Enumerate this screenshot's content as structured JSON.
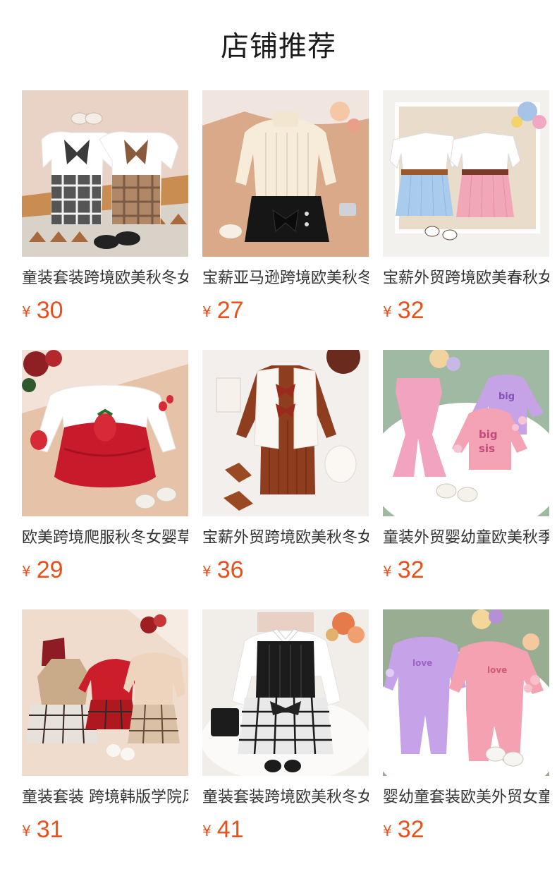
{
  "header": {
    "title": "店铺推荐"
  },
  "currency_symbol": "¥",
  "colors": {
    "price": "#e8501c",
    "title": "#1a1a1a",
    "name": "#333333"
  },
  "products": [
    {
      "name": "童装套装跨境欧美秋冬女童长袖上衣格子半身裙两件套",
      "price": "30",
      "image": "white-bow-tops-plaid-skirts-photo"
    },
    {
      "name": "宝薪亚马逊跨境欧美秋冬女童针织上衣蝴蝶结短裤套装",
      "price": "27",
      "image": "cream-knit-top-black-bow-skort-photo"
    },
    {
      "name": "宝薪外贸跨境欧美春秋女童吊带上衣百褶裙两件套",
      "price": "32",
      "image": "white-tops-blue-pink-pleated-skirts-photo"
    },
    {
      "name": "欧美跨境爬服秋冬女婴草莓连体衣哈衣",
      "price": "29",
      "image": "white-red-strawberry-romper-photo"
    },
    {
      "name": "宝薪外贸跨境欧美秋冬女童毛绒马甲针织裙套装",
      "price": "36",
      "image": "brown-dress-white-fur-vest-photo"
    },
    {
      "name": "童装外贸婴幼童欧美秋季女童卫衣喇叭裤套装",
      "price": "32",
      "image": "pink-purple-big-sis-flare-pants-photo"
    },
    {
      "name": "童装套装 跨境韩版学院风女童格子裙套装",
      "price": "31",
      "image": "collar-tops-plaid-skirts-set-photo"
    },
    {
      "name": "童装套装跨境欧美秋冬女童衬衫针织马甲格子裙",
      "price": "41",
      "image": "white-shirt-black-vest-tweed-skirt-photo"
    },
    {
      "name": "婴幼童套装欧美外贸女童卫衣长裤两件套",
      "price": "32",
      "image": "purple-pink-sweatshirt-joggers-photo"
    }
  ]
}
